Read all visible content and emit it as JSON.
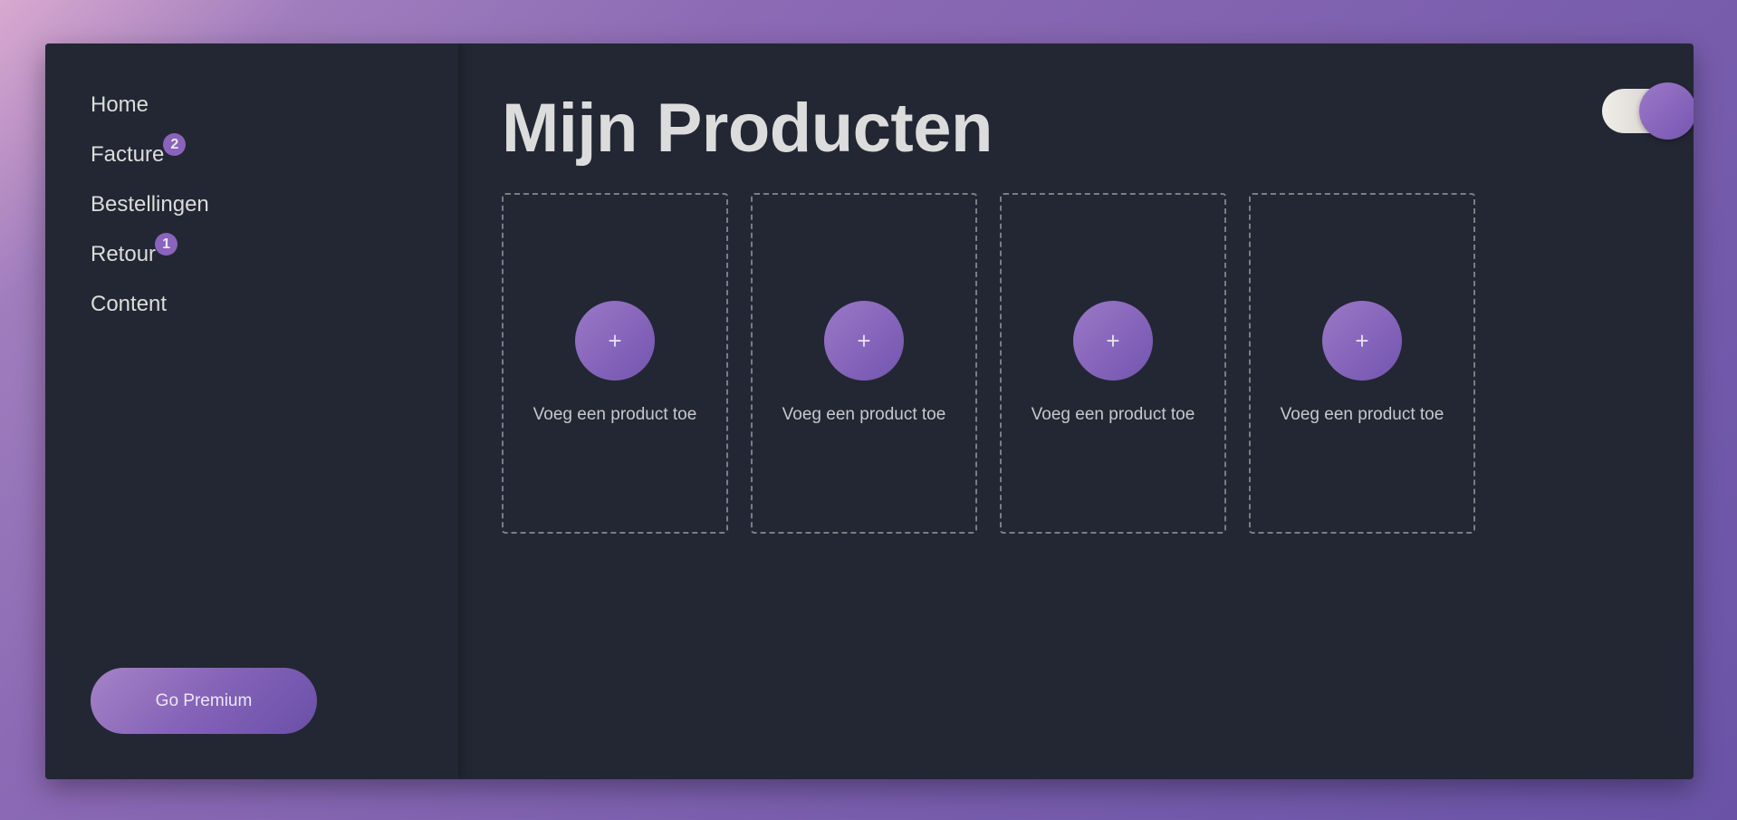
{
  "sidebar": {
    "nav": [
      {
        "label": "Home",
        "badge": ""
      },
      {
        "label": "Facture",
        "badge": "2"
      },
      {
        "label": "Bestellingen",
        "badge": ""
      },
      {
        "label": "Retour",
        "badge": "1"
      },
      {
        "label": "Content",
        "badge": ""
      }
    ],
    "premium_button": "Go Premium"
  },
  "main": {
    "title": "Mijn Producten",
    "theme_toggle": {
      "state": "on"
    },
    "cards": [
      {
        "icon": "+",
        "label": "Voeg een product toe"
      },
      {
        "icon": "+",
        "label": "Voeg een product toe"
      },
      {
        "icon": "+",
        "label": "Voeg een product toe"
      },
      {
        "icon": "+",
        "label": "Voeg een product toe"
      }
    ]
  },
  "colors": {
    "accent": "#8a63bd",
    "panel": "#222733",
    "text": "#dcdcdc"
  }
}
